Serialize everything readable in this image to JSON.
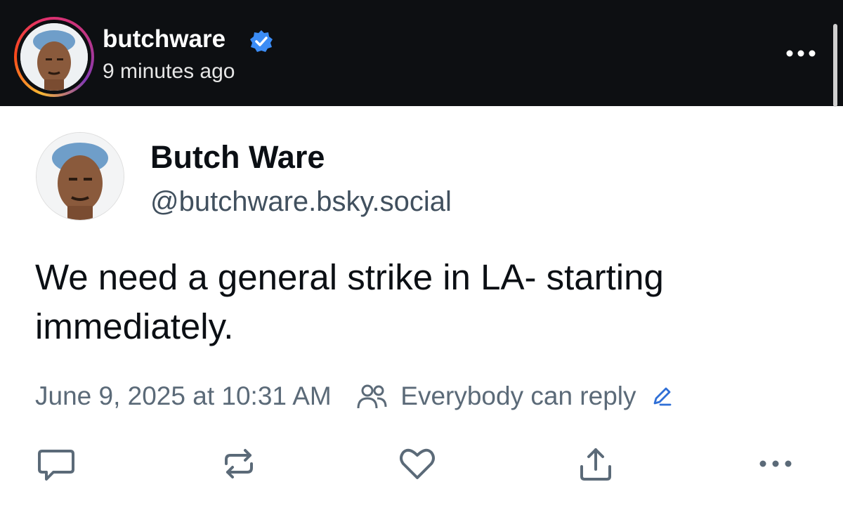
{
  "story_header": {
    "username": "butchware",
    "time": "9 minutes ago",
    "icons": {
      "verified": "verified-badge-icon",
      "more": "more-horizontal-icon"
    },
    "colors": {
      "background": "#0d0f12",
      "verified": "#3b8cf5"
    }
  },
  "post": {
    "display_name": "Butch Ware",
    "handle": "@butchware.bsky.social",
    "text": "We need a general strike in LA- starting immediately.",
    "timestamp": "June 9, 2025 at 10:31 AM",
    "reply_setting": "Everybody can reply",
    "colors": {
      "link": "#2f6fd6",
      "muted": "#5b6a78",
      "action_icons": "#5b6a78"
    }
  },
  "actions": [
    {
      "name": "reply",
      "icon": "comment-icon"
    },
    {
      "name": "repost",
      "icon": "repost-icon"
    },
    {
      "name": "like",
      "icon": "heart-icon"
    },
    {
      "name": "share",
      "icon": "share-icon"
    },
    {
      "name": "more",
      "icon": "more-horizontal-icon"
    }
  ]
}
